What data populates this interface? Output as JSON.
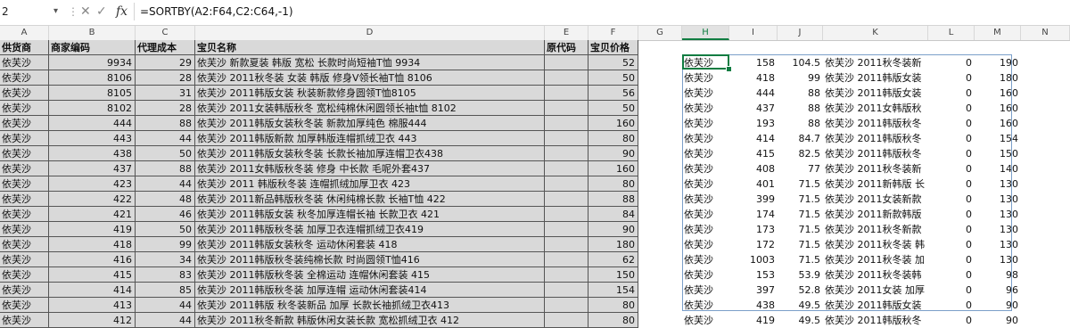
{
  "formula_bar": {
    "name_box": "2",
    "cancel_icon": "✕",
    "enter_icon": "✓",
    "fx_label": "fx",
    "formula": "=SORTBY(A2:F64,C2:C64,-1)"
  },
  "columns": [
    "A",
    "B",
    "C",
    "D",
    "E",
    "F",
    "G",
    "H",
    "I",
    "J",
    "K",
    "L",
    "M",
    "N"
  ],
  "selected_column": "H",
  "headers": {
    "A": "供货商",
    "B": "商家编码",
    "C": "代理成本",
    "D": "宝贝名称",
    "E": "原代码",
    "F": "宝贝价格"
  },
  "left_rows": [
    {
      "a": "依芙沙",
      "b": "9934",
      "c": "29",
      "d": "依芙沙 新款夏装 韩版 宽松 长款时尚短袖T恤 9934",
      "e": "",
      "f": "52"
    },
    {
      "a": "依芙沙",
      "b": "8106",
      "c": "28",
      "d": "依芙沙 2011秋冬装 女装 韩版 修身V领长袖T恤 8106",
      "e": "",
      "f": "50"
    },
    {
      "a": "依芙沙",
      "b": "8105",
      "c": "31",
      "d": "依芙沙 2011韩版女装 秋装新款修身圆领T恤8105",
      "e": "",
      "f": "56"
    },
    {
      "a": "依芙沙",
      "b": "8102",
      "c": "28",
      "d": "依芙沙 2011女装韩版秋冬 宽松纯棉休闲圆领长袖t恤 8102",
      "e": "",
      "f": "50"
    },
    {
      "a": "依芙沙",
      "b": "444",
      "c": "88",
      "d": "依芙沙 2011韩版女装秋冬装 新款加厚纯色 棉服444",
      "e": "",
      "f": "160"
    },
    {
      "a": "依芙沙",
      "b": "443",
      "c": "44",
      "d": "依芙沙 2011韩版新款 加厚韩版连帽抓绒卫衣 443",
      "e": "",
      "f": "80"
    },
    {
      "a": "依芙沙",
      "b": "438",
      "c": "50",
      "d": "依芙沙 2011韩版女装秋冬装 长款长袖加厚连帽卫衣438",
      "e": "",
      "f": "90"
    },
    {
      "a": "依芙沙",
      "b": "437",
      "c": "88",
      "d": "依芙沙 2011女韩版秋冬装 修身 中长款 毛呢外套437",
      "e": "",
      "f": "160"
    },
    {
      "a": "依芙沙",
      "b": "423",
      "c": "44",
      "d": "依芙沙 2011 韩版秋冬装 连帽抓绒加厚卫衣 423",
      "e": "",
      "f": "80"
    },
    {
      "a": "依芙沙",
      "b": "422",
      "c": "48",
      "d": "依芙沙 2011新品韩版秋冬装 休闲纯棉长款 长袖T恤 422",
      "e": "",
      "f": "88"
    },
    {
      "a": "依芙沙",
      "b": "421",
      "c": "46",
      "d": "依芙沙 2011韩版女装 秋冬加厚连帽长袖 长款卫衣 421",
      "e": "",
      "f": "84"
    },
    {
      "a": "依芙沙",
      "b": "419",
      "c": "50",
      "d": "依芙沙 2011韩版秋冬装 加厚卫衣连帽抓绒卫衣419",
      "e": "",
      "f": "90"
    },
    {
      "a": "依芙沙",
      "b": "418",
      "c": "99",
      "d": "依芙沙 2011韩版女装秋冬 运动休闲套装 418",
      "e": "",
      "f": "180"
    },
    {
      "a": "依芙沙",
      "b": "416",
      "c": "34",
      "d": "依芙沙 2011韩版秋冬装纯棉长款 时尚圆领T恤416",
      "e": "",
      "f": "62"
    },
    {
      "a": "依芙沙",
      "b": "415",
      "c": "83",
      "d": "依芙沙 2011韩版秋冬装 全棉运动 连帽休闲套装 415",
      "e": "",
      "f": "150"
    },
    {
      "a": "依芙沙",
      "b": "414",
      "c": "85",
      "d": "依芙沙 2011韩版秋冬装 加厚连帽 运动休闲套装414",
      "e": "",
      "f": "154"
    },
    {
      "a": "依芙沙",
      "b": "413",
      "c": "44",
      "d": "依芙沙 2011韩版 秋冬装新品 加厚 长款长袖抓绒卫衣413",
      "e": "",
      "f": "80"
    },
    {
      "a": "依芙沙",
      "b": "412",
      "c": "44",
      "d": "依芙沙 2011秋冬新款 韩版休闲女装长款 宽松抓绒卫衣 412",
      "e": "",
      "f": "80"
    }
  ],
  "right_rows": [
    {
      "h": "依芙沙",
      "i": "158",
      "j": "104.5",
      "k": "依芙沙 2011秋冬装新",
      "l": "0",
      "m": "190"
    },
    {
      "h": "依芙沙",
      "i": "418",
      "j": "99",
      "k": "依芙沙 2011韩版女装",
      "l": "0",
      "m": "180"
    },
    {
      "h": "依芙沙",
      "i": "444",
      "j": "88",
      "k": "依芙沙 2011韩版女装",
      "l": "0",
      "m": "160"
    },
    {
      "h": "依芙沙",
      "i": "437",
      "j": "88",
      "k": "依芙沙 2011女韩版秋",
      "l": "0",
      "m": "160"
    },
    {
      "h": "依芙沙",
      "i": "193",
      "j": "88",
      "k": "依芙沙 2011韩版秋冬",
      "l": "0",
      "m": "160"
    },
    {
      "h": "依芙沙",
      "i": "414",
      "j": "84.7",
      "k": "依芙沙 2011韩版秋冬",
      "l": "0",
      "m": "154"
    },
    {
      "h": "依芙沙",
      "i": "415",
      "j": "82.5",
      "k": "依芙沙 2011韩版秋冬",
      "l": "0",
      "m": "150"
    },
    {
      "h": "依芙沙",
      "i": "408",
      "j": "77",
      "k": "依芙沙 2011秋冬装新",
      "l": "0",
      "m": "140"
    },
    {
      "h": "依芙沙",
      "i": "401",
      "j": "71.5",
      "k": "依芙沙 2011新韩版 长",
      "l": "0",
      "m": "130"
    },
    {
      "h": "依芙沙",
      "i": "399",
      "j": "71.5",
      "k": "依芙沙 2011女装新款",
      "l": "0",
      "m": "130"
    },
    {
      "h": "依芙沙",
      "i": "174",
      "j": "71.5",
      "k": "依芙沙 2011新款韩版",
      "l": "0",
      "m": "130"
    },
    {
      "h": "依芙沙",
      "i": "173",
      "j": "71.5",
      "k": "依芙沙 2011秋冬新款",
      "l": "0",
      "m": "130"
    },
    {
      "h": "依芙沙",
      "i": "172",
      "j": "71.5",
      "k": "依芙沙 2011秋冬装 韩",
      "l": "0",
      "m": "130"
    },
    {
      "h": "依芙沙",
      "i": "1003",
      "j": "71.5",
      "k": "依芙沙 2011秋冬装 加",
      "l": "0",
      "m": "130"
    },
    {
      "h": "依芙沙",
      "i": "153",
      "j": "53.9",
      "k": "依芙沙 2011秋冬装韩",
      "l": "0",
      "m": "98"
    },
    {
      "h": "依芙沙",
      "i": "397",
      "j": "52.8",
      "k": "依芙沙 2011女装 加厚",
      "l": "0",
      "m": "96"
    },
    {
      "h": "依芙沙",
      "i": "438",
      "j": "49.5",
      "k": "依芙沙 2011韩版女装",
      "l": "0",
      "m": "90"
    },
    {
      "h": "依芙沙",
      "i": "419",
      "j": "49.5",
      "k": "依芙沙 2011韩版秋冬",
      "l": "0",
      "m": "90"
    }
  ]
}
